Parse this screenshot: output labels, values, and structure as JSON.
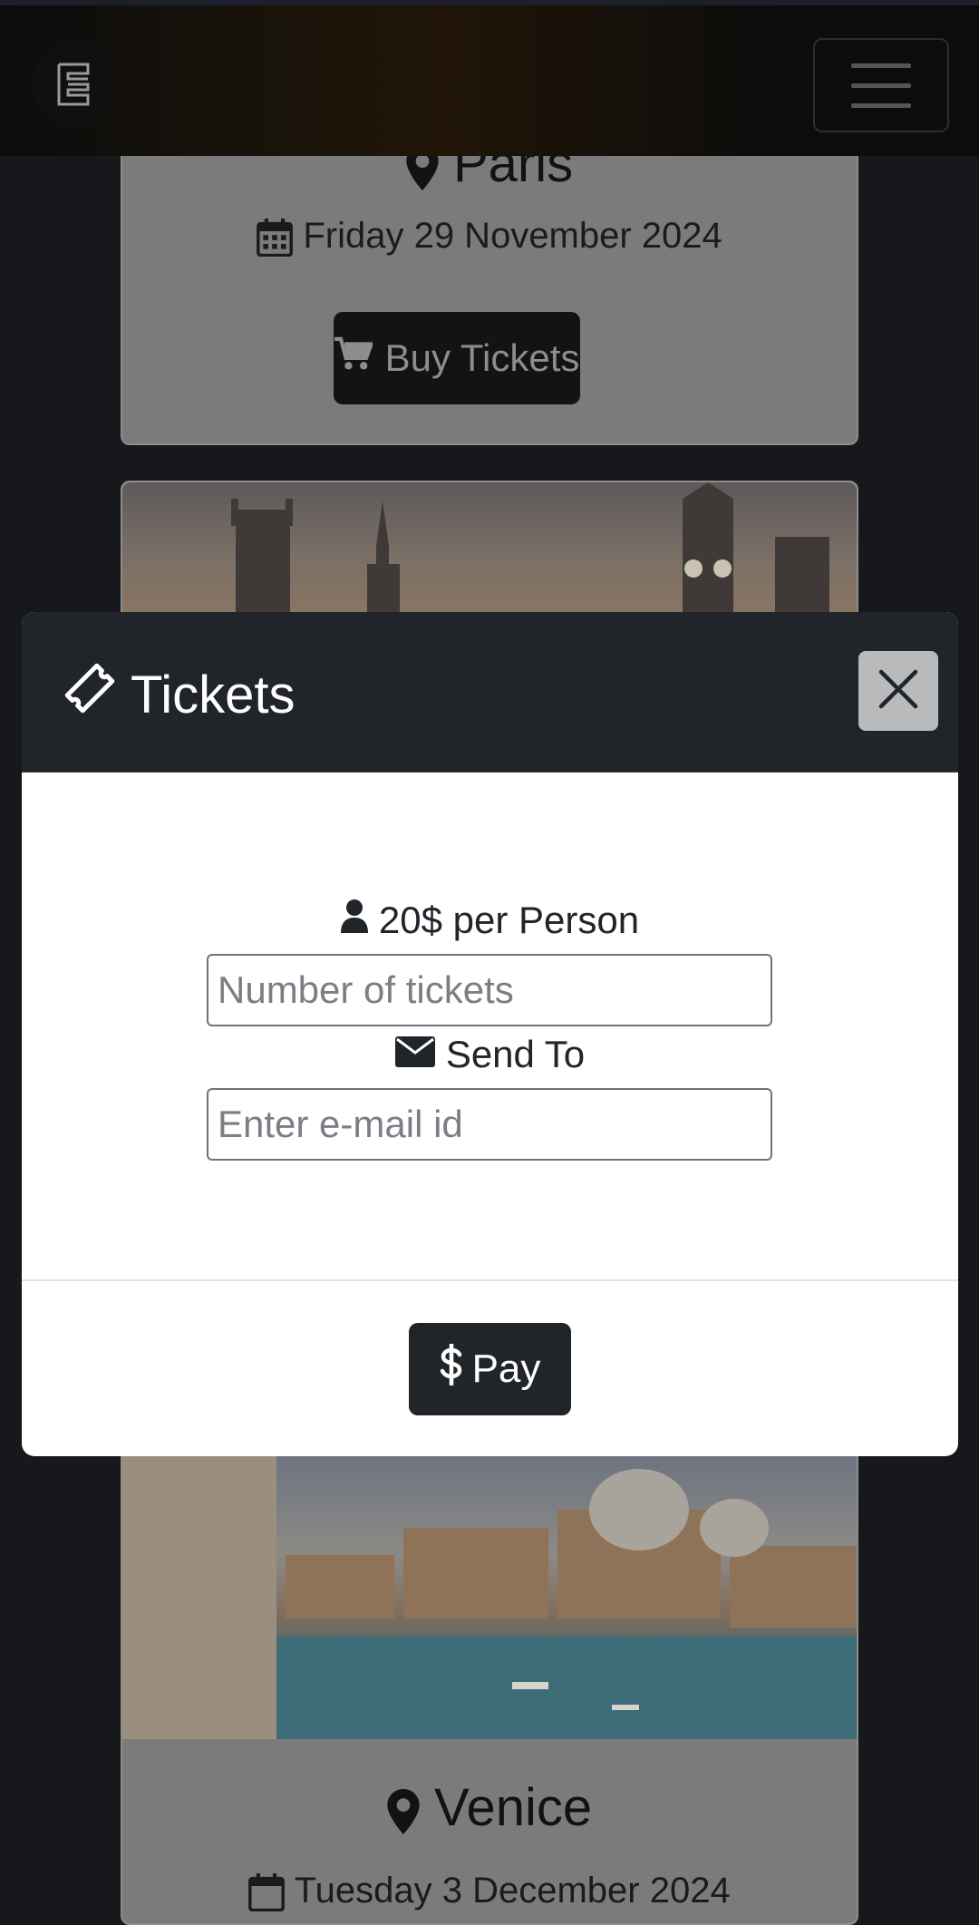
{
  "event_cards": [
    {
      "city": "Paris",
      "date": "Friday 29 November 2024",
      "buy_label": "Buy Tickets"
    },
    {
      "city": "Venice",
      "date": "Tuesday 3 December 2024"
    }
  ],
  "modal": {
    "title": "Tickets",
    "price_label": "20$ per Person",
    "tickets_placeholder": "Number of tickets",
    "send_to_label": "Send To",
    "email_placeholder": "Enter e-mail id",
    "pay_label": "Pay"
  },
  "colors": {
    "modal_header": "#212529",
    "button_dark": "#212529",
    "close_button": "#b9babb",
    "backdrop": "#16181b"
  },
  "icons": [
    "logo-icon",
    "menu-icon",
    "map-marker-icon",
    "calendar-icon",
    "cart-icon",
    "ticket-icon",
    "close-icon",
    "user-icon",
    "envelope-icon",
    "dollar-icon"
  ]
}
